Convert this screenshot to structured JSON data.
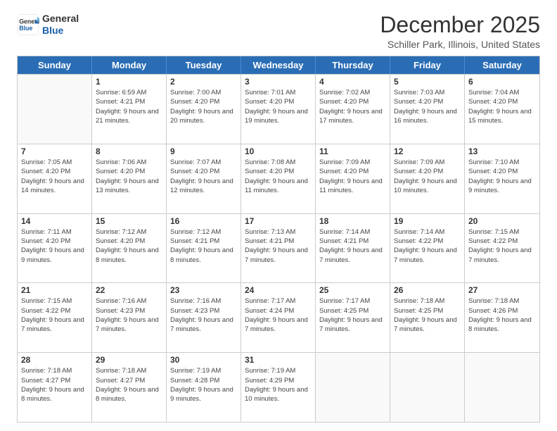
{
  "logo": {
    "line1": "General",
    "line2": "Blue"
  },
  "title": "December 2025",
  "subtitle": "Schiller Park, Illinois, United States",
  "weekdays": [
    "Sunday",
    "Monday",
    "Tuesday",
    "Wednesday",
    "Thursday",
    "Friday",
    "Saturday"
  ],
  "weeks": [
    [
      {
        "day": "",
        "sunrise": "",
        "sunset": "",
        "daylight": ""
      },
      {
        "day": "1",
        "sunrise": "Sunrise: 6:59 AM",
        "sunset": "Sunset: 4:21 PM",
        "daylight": "Daylight: 9 hours and 21 minutes."
      },
      {
        "day": "2",
        "sunrise": "Sunrise: 7:00 AM",
        "sunset": "Sunset: 4:20 PM",
        "daylight": "Daylight: 9 hours and 20 minutes."
      },
      {
        "day": "3",
        "sunrise": "Sunrise: 7:01 AM",
        "sunset": "Sunset: 4:20 PM",
        "daylight": "Daylight: 9 hours and 19 minutes."
      },
      {
        "day": "4",
        "sunrise": "Sunrise: 7:02 AM",
        "sunset": "Sunset: 4:20 PM",
        "daylight": "Daylight: 9 hours and 17 minutes."
      },
      {
        "day": "5",
        "sunrise": "Sunrise: 7:03 AM",
        "sunset": "Sunset: 4:20 PM",
        "daylight": "Daylight: 9 hours and 16 minutes."
      },
      {
        "day": "6",
        "sunrise": "Sunrise: 7:04 AM",
        "sunset": "Sunset: 4:20 PM",
        "daylight": "Daylight: 9 hours and 15 minutes."
      }
    ],
    [
      {
        "day": "7",
        "sunrise": "Sunrise: 7:05 AM",
        "sunset": "Sunset: 4:20 PM",
        "daylight": "Daylight: 9 hours and 14 minutes."
      },
      {
        "day": "8",
        "sunrise": "Sunrise: 7:06 AM",
        "sunset": "Sunset: 4:20 PM",
        "daylight": "Daylight: 9 hours and 13 minutes."
      },
      {
        "day": "9",
        "sunrise": "Sunrise: 7:07 AM",
        "sunset": "Sunset: 4:20 PM",
        "daylight": "Daylight: 9 hours and 12 minutes."
      },
      {
        "day": "10",
        "sunrise": "Sunrise: 7:08 AM",
        "sunset": "Sunset: 4:20 PM",
        "daylight": "Daylight: 9 hours and 11 minutes."
      },
      {
        "day": "11",
        "sunrise": "Sunrise: 7:09 AM",
        "sunset": "Sunset: 4:20 PM",
        "daylight": "Daylight: 9 hours and 11 minutes."
      },
      {
        "day": "12",
        "sunrise": "Sunrise: 7:09 AM",
        "sunset": "Sunset: 4:20 PM",
        "daylight": "Daylight: 9 hours and 10 minutes."
      },
      {
        "day": "13",
        "sunrise": "Sunrise: 7:10 AM",
        "sunset": "Sunset: 4:20 PM",
        "daylight": "Daylight: 9 hours and 9 minutes."
      }
    ],
    [
      {
        "day": "14",
        "sunrise": "Sunrise: 7:11 AM",
        "sunset": "Sunset: 4:20 PM",
        "daylight": "Daylight: 9 hours and 9 minutes."
      },
      {
        "day": "15",
        "sunrise": "Sunrise: 7:12 AM",
        "sunset": "Sunset: 4:20 PM",
        "daylight": "Daylight: 9 hours and 8 minutes."
      },
      {
        "day": "16",
        "sunrise": "Sunrise: 7:12 AM",
        "sunset": "Sunset: 4:21 PM",
        "daylight": "Daylight: 9 hours and 8 minutes."
      },
      {
        "day": "17",
        "sunrise": "Sunrise: 7:13 AM",
        "sunset": "Sunset: 4:21 PM",
        "daylight": "Daylight: 9 hours and 7 minutes."
      },
      {
        "day": "18",
        "sunrise": "Sunrise: 7:14 AM",
        "sunset": "Sunset: 4:21 PM",
        "daylight": "Daylight: 9 hours and 7 minutes."
      },
      {
        "day": "19",
        "sunrise": "Sunrise: 7:14 AM",
        "sunset": "Sunset: 4:22 PM",
        "daylight": "Daylight: 9 hours and 7 minutes."
      },
      {
        "day": "20",
        "sunrise": "Sunrise: 7:15 AM",
        "sunset": "Sunset: 4:22 PM",
        "daylight": "Daylight: 9 hours and 7 minutes."
      }
    ],
    [
      {
        "day": "21",
        "sunrise": "Sunrise: 7:15 AM",
        "sunset": "Sunset: 4:22 PM",
        "daylight": "Daylight: 9 hours and 7 minutes."
      },
      {
        "day": "22",
        "sunrise": "Sunrise: 7:16 AM",
        "sunset": "Sunset: 4:23 PM",
        "daylight": "Daylight: 9 hours and 7 minutes."
      },
      {
        "day": "23",
        "sunrise": "Sunrise: 7:16 AM",
        "sunset": "Sunset: 4:23 PM",
        "daylight": "Daylight: 9 hours and 7 minutes."
      },
      {
        "day": "24",
        "sunrise": "Sunrise: 7:17 AM",
        "sunset": "Sunset: 4:24 PM",
        "daylight": "Daylight: 9 hours and 7 minutes."
      },
      {
        "day": "25",
        "sunrise": "Sunrise: 7:17 AM",
        "sunset": "Sunset: 4:25 PM",
        "daylight": "Daylight: 9 hours and 7 minutes."
      },
      {
        "day": "26",
        "sunrise": "Sunrise: 7:18 AM",
        "sunset": "Sunset: 4:25 PM",
        "daylight": "Daylight: 9 hours and 7 minutes."
      },
      {
        "day": "27",
        "sunrise": "Sunrise: 7:18 AM",
        "sunset": "Sunset: 4:26 PM",
        "daylight": "Daylight: 9 hours and 8 minutes."
      }
    ],
    [
      {
        "day": "28",
        "sunrise": "Sunrise: 7:18 AM",
        "sunset": "Sunset: 4:27 PM",
        "daylight": "Daylight: 9 hours and 8 minutes."
      },
      {
        "day": "29",
        "sunrise": "Sunrise: 7:18 AM",
        "sunset": "Sunset: 4:27 PM",
        "daylight": "Daylight: 9 hours and 8 minutes."
      },
      {
        "day": "30",
        "sunrise": "Sunrise: 7:19 AM",
        "sunset": "Sunset: 4:28 PM",
        "daylight": "Daylight: 9 hours and 9 minutes."
      },
      {
        "day": "31",
        "sunrise": "Sunrise: 7:19 AM",
        "sunset": "Sunset: 4:29 PM",
        "daylight": "Daylight: 9 hours and 10 minutes."
      },
      {
        "day": "",
        "sunrise": "",
        "sunset": "",
        "daylight": ""
      },
      {
        "day": "",
        "sunrise": "",
        "sunset": "",
        "daylight": ""
      },
      {
        "day": "",
        "sunrise": "",
        "sunset": "",
        "daylight": ""
      }
    ]
  ]
}
